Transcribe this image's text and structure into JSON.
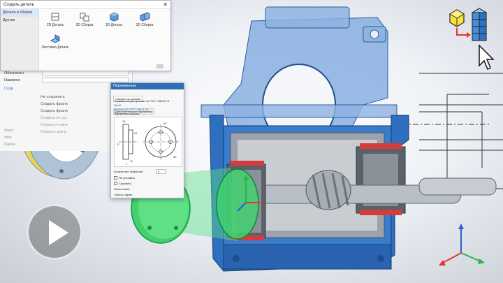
{
  "create_dialog": {
    "title": "Создать деталь",
    "close_glyph": "✕",
    "categories": [
      "Детали и сборки",
      "Другие"
    ],
    "templates": [
      {
        "label": "2D Деталь",
        "icon": "part-2d-icon"
      },
      {
        "label": "2D Сборка",
        "icon": "assembly-2d-icon"
      },
      {
        "label": "3D Деталь",
        "icon": "part-3d-icon"
      },
      {
        "label": "3D Сборка",
        "icon": "assembly-3d-icon"
      },
      {
        "label": "Листовая Деталь",
        "icon": "sheet-metal-part-icon"
      }
    ]
  },
  "properties_panel": {
    "labels": [
      "Обозначен",
      "Наимено",
      "Созд"
    ],
    "menu_items": [
      "Не сохранять",
      "Создать фрагм",
      "Создать фрагм",
      "Создать по ша",
      "Открыть в окне",
      "Открыть для р"
    ],
    "lower_labels": [
      "Файл",
      "Имя",
      "Папка"
    ]
  },
  "param_dialog": {
    "title": "Переменные",
    "tabs": [
      "Параметры крышки",
      "Дополнительные параметры"
    ],
    "lines": [
      "Торцевая серия крышки по ГОСТ 18511-73",
      "Тип:2",
      "Крышки 01 ГОСТ 18511-73",
      "Параметры крышки"
    ],
    "dims": [
      "10",
      "D",
      "d1",
      "d2",
      "d3",
      "L",
      "11"
    ],
    "field_label": "Количество отверстий",
    "field_value": "4",
    "checkbox_1": "Не рисовать",
    "checkbox_2": "Скрывать",
    "dropdown_label": "Исполнение",
    "footer": "Список парам"
  },
  "icons": {
    "view_cube": "view-cube-icon",
    "cursor": "mouse-cursor-icon",
    "axes": "coordinate-axes-icon",
    "play": "play-icon"
  },
  "colors": {
    "housing_blue": "#2f6fc0",
    "housing_glass": "#6f9fd8",
    "ring_yellow": "#e6d65a",
    "cover_green": "#39d46c",
    "shaft_grey": "#b9bfc7",
    "dialog_blue": "#2f6db5",
    "axis_red": "#e0392f",
    "axis_green": "#2fb34a",
    "axis_blue": "#2e5fcf"
  }
}
